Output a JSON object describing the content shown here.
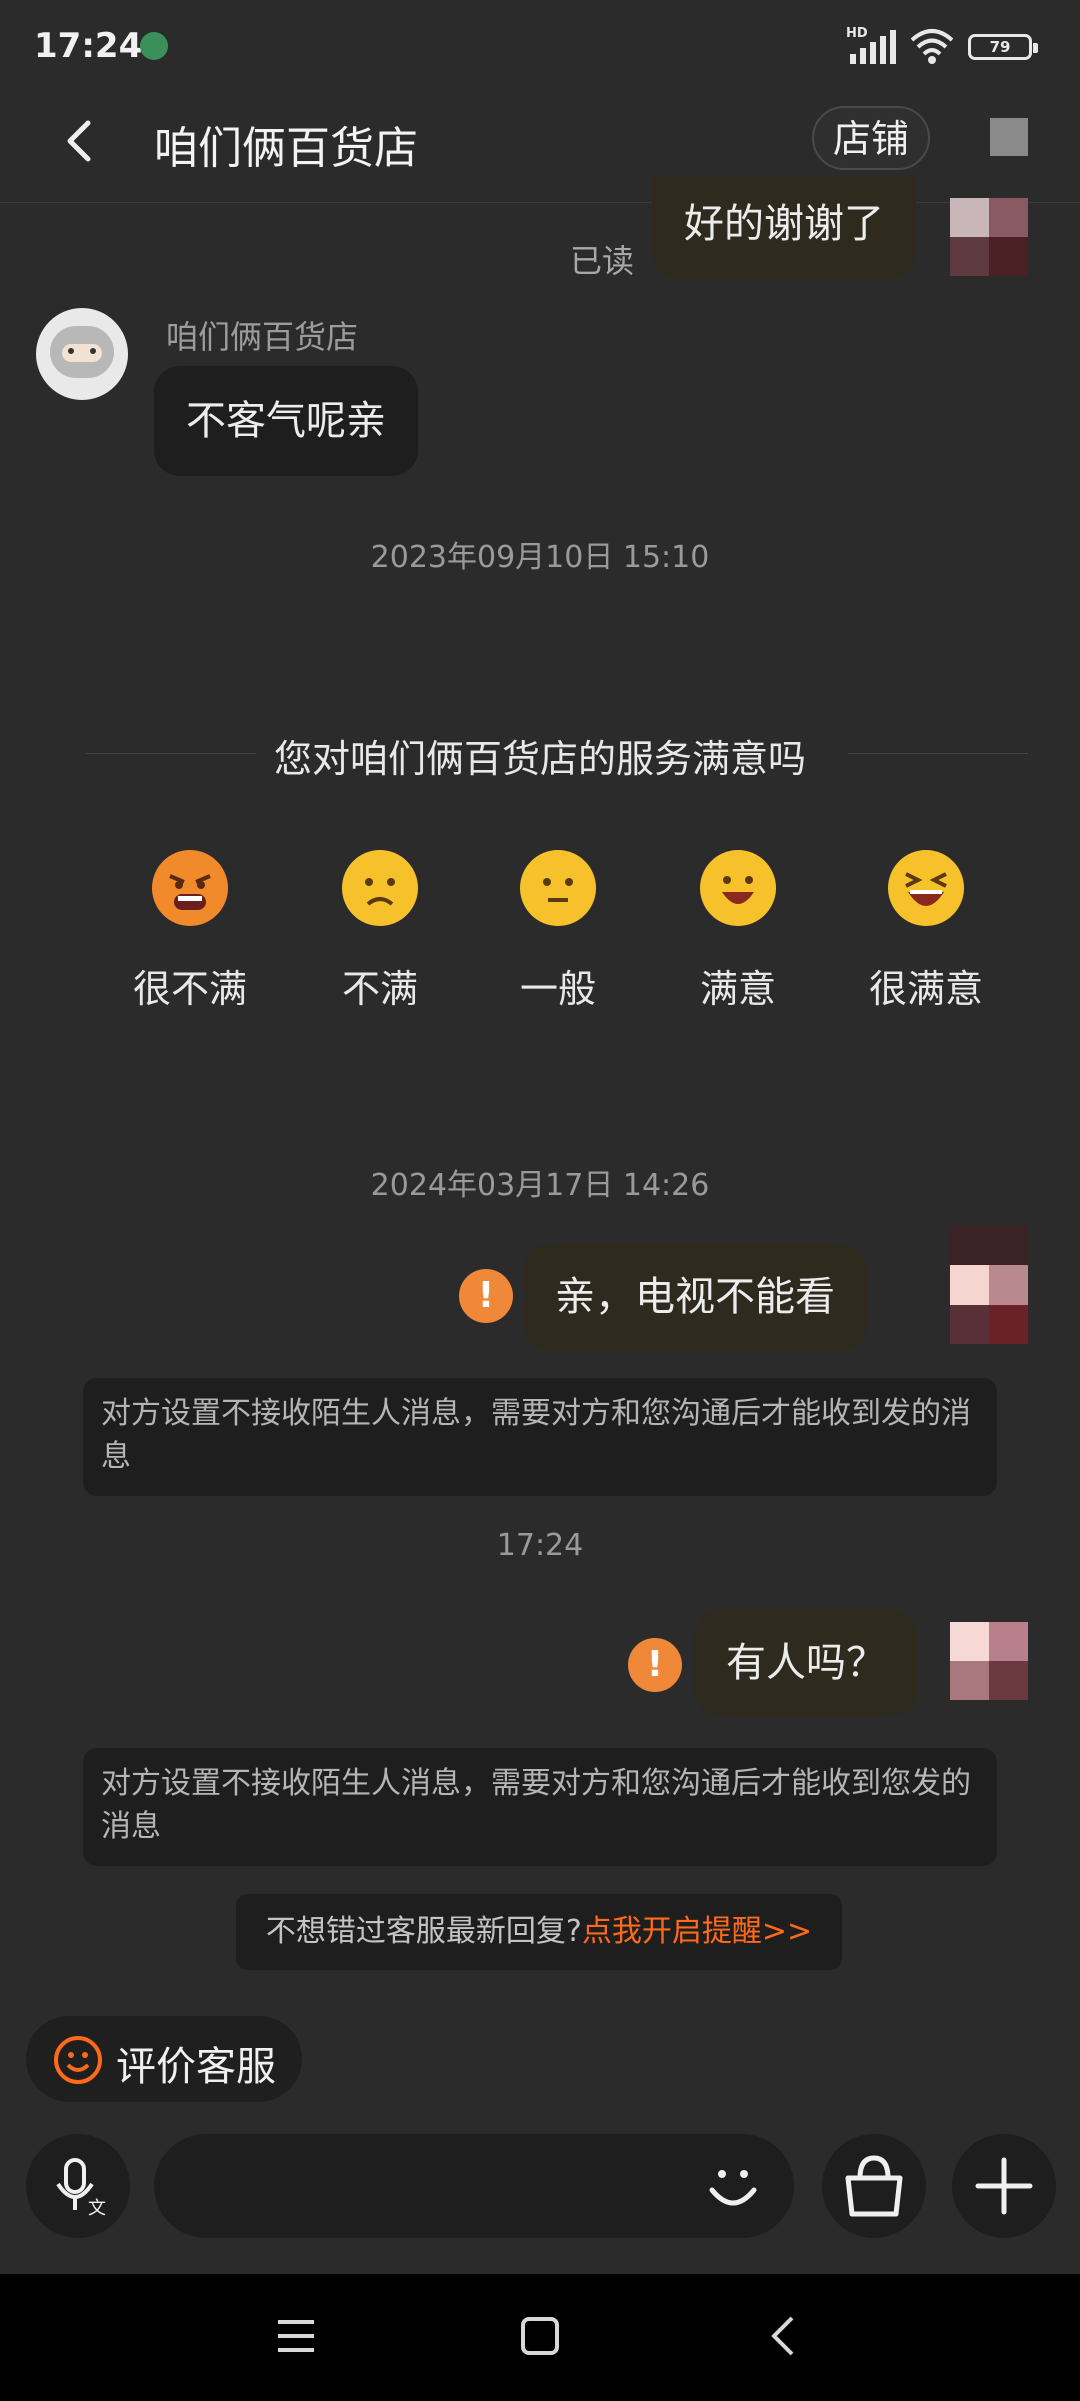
{
  "status_bar": {
    "time": "17:24",
    "network": "HD",
    "battery": "79"
  },
  "header": {
    "title": "咱们俩百货店",
    "store_button": "店铺"
  },
  "messages": {
    "first_mine": {
      "text": "好的谢谢了",
      "status": "已读"
    },
    "store_reply": {
      "sender": "咱们俩百货店",
      "text": "不客气呢亲"
    },
    "timestamp1": "2023年09月10日 15:10",
    "timestamp2": "2024年03月17日 14:26",
    "second_mine": {
      "text": "亲，电视不能看"
    },
    "notice1": "对方设置不接收陌生人消息，需要对方和您沟通后才能收到发的消息",
    "timestamp3": "17:24",
    "third_mine": {
      "text": "有人吗？"
    },
    "notice2": "对方设置不接收陌生人消息，需要对方和您沟通后才能收到您发的消息"
  },
  "survey": {
    "question": "您对咱们俩百货店的服务满意吗",
    "options": [
      {
        "label": "很不满",
        "icon": "very-unsatisfied-face-icon"
      },
      {
        "label": "不满",
        "icon": "unsatisfied-face-icon"
      },
      {
        "label": "一般",
        "icon": "neutral-face-icon"
      },
      {
        "label": "满意",
        "icon": "satisfied-face-icon"
      },
      {
        "label": "很满意",
        "icon": "very-satisfied-face-icon"
      }
    ]
  },
  "reminder": {
    "text": "不想错过客服最新回复?",
    "link": "点我开启提醒>>"
  },
  "rate_button": "评价客服",
  "colors": {
    "accent": "#ff6a1a",
    "warning": "#f0883a",
    "emoji": "#f6c12a",
    "background": "#2b2b2c"
  }
}
